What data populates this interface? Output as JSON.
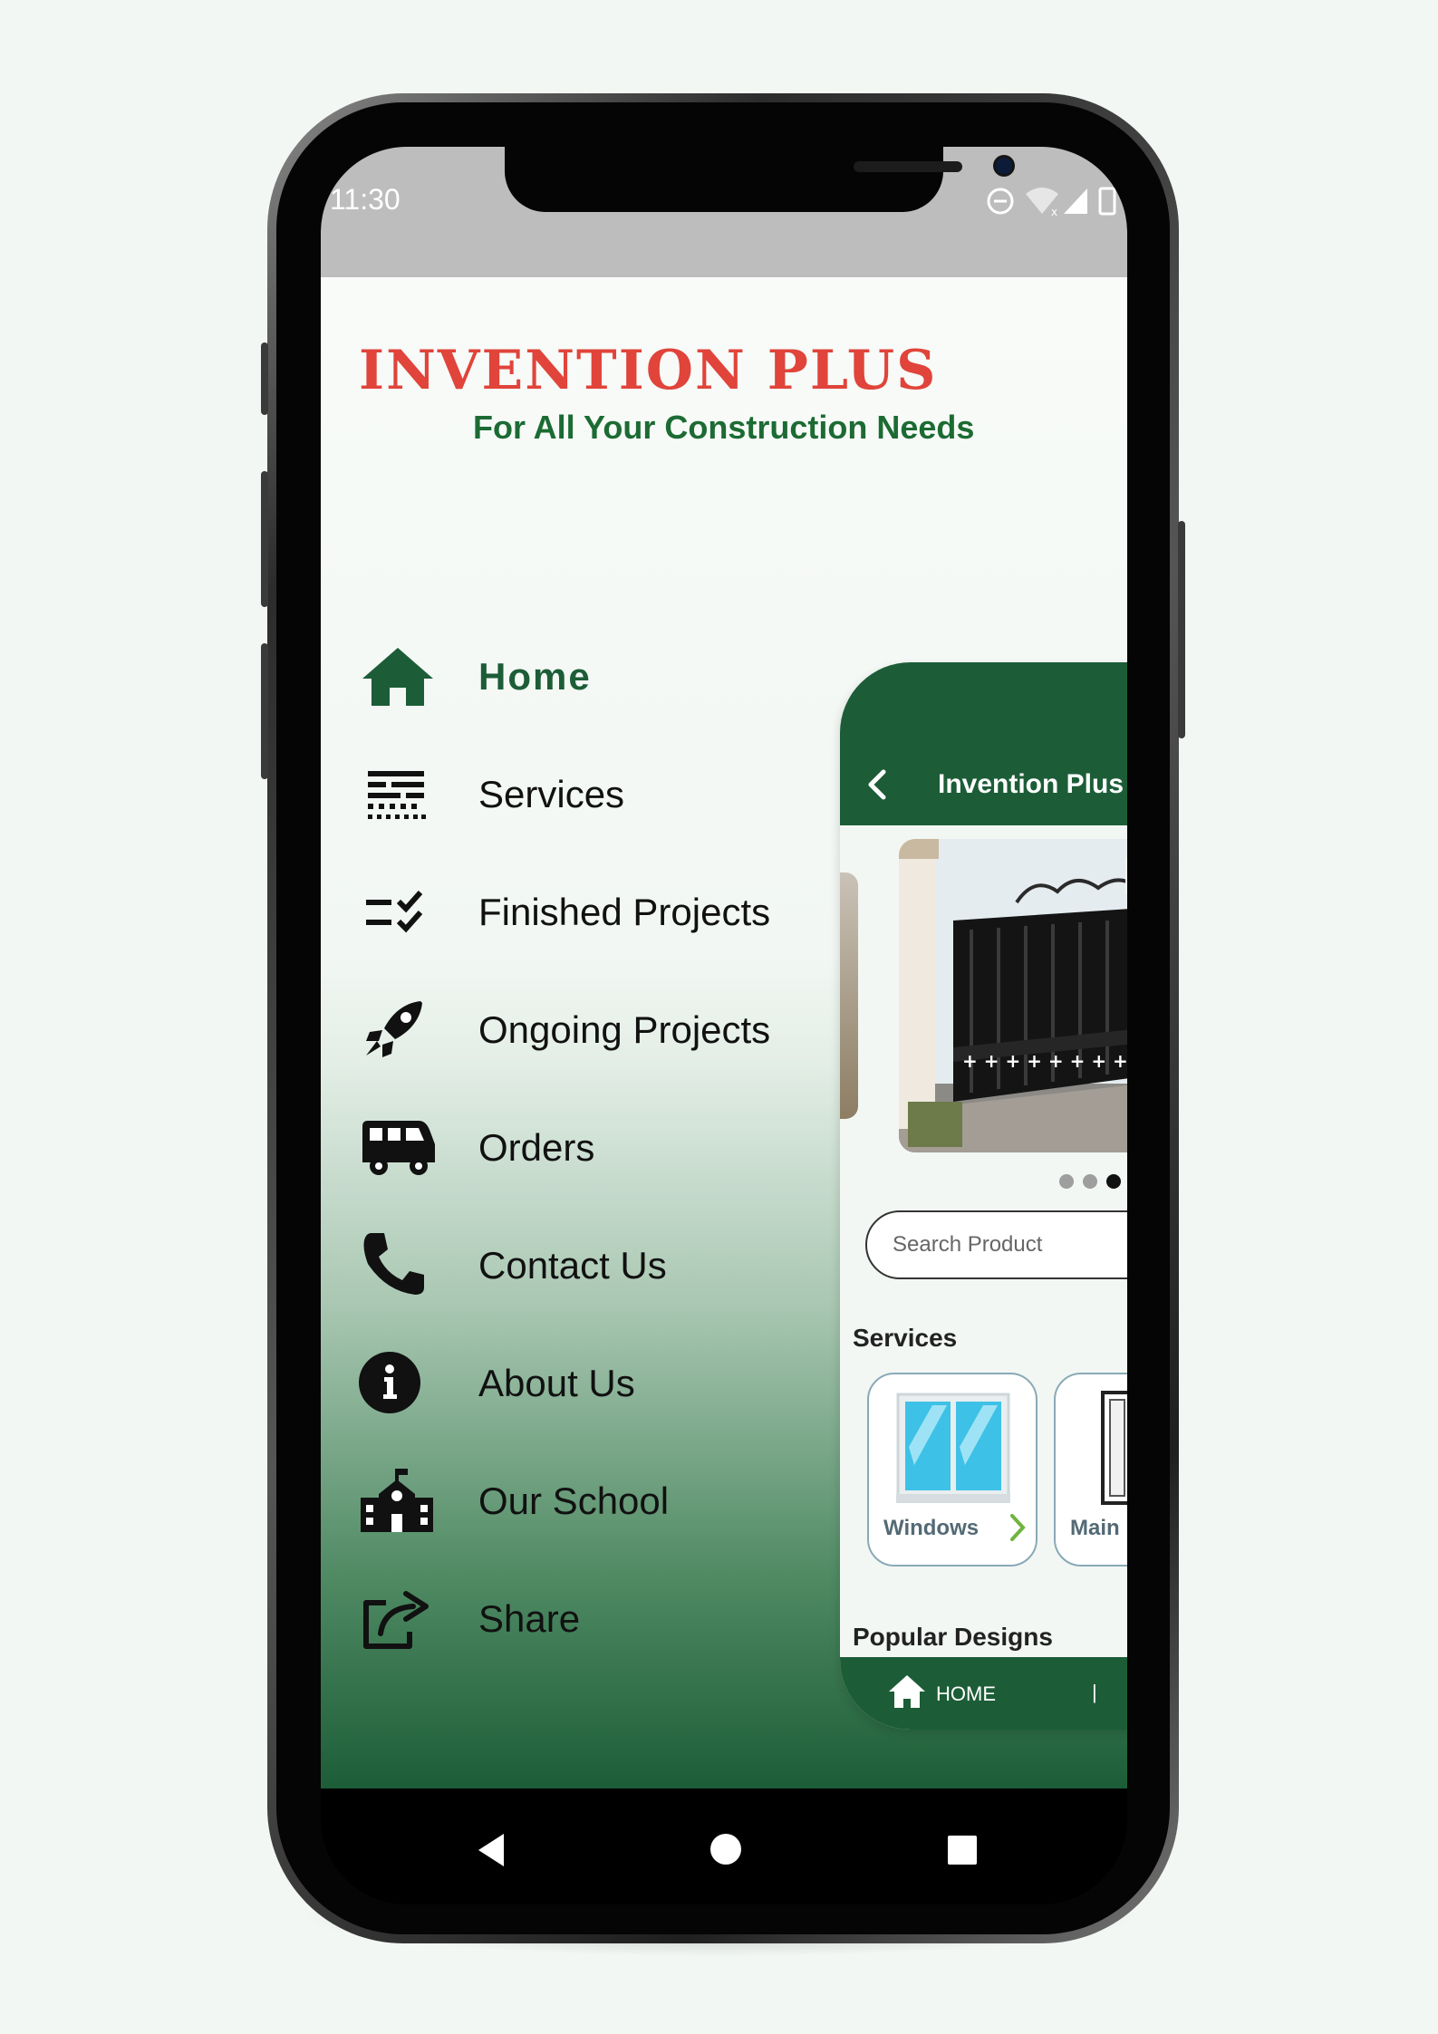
{
  "status_bar": {
    "time": "11:30"
  },
  "brand": {
    "title": "INVENTION PLUS",
    "tagline": "For All Your Construction Needs",
    "title_color": "#e0443a",
    "tagline_color": "#1c6b33",
    "accent": "#1c5d37"
  },
  "drawer": {
    "items": [
      {
        "label": "Home",
        "icon": "home-icon",
        "active": true
      },
      {
        "label": "Services",
        "icon": "services-icon",
        "active": false
      },
      {
        "label": "Finished Projects",
        "icon": "checklist-icon",
        "active": false
      },
      {
        "label": "Ongoing Projects",
        "icon": "rocket-icon",
        "active": false
      },
      {
        "label": "Orders",
        "icon": "van-icon",
        "active": false
      },
      {
        "label": "Contact Us",
        "icon": "phone-icon",
        "active": false
      },
      {
        "label": "About Us",
        "icon": "info-icon",
        "active": false
      },
      {
        "label": "Our School",
        "icon": "school-icon",
        "active": false
      },
      {
        "label": "Share",
        "icon": "share-icon",
        "active": false
      }
    ]
  },
  "preview": {
    "header_title": "Invention Plus C",
    "carousel": {
      "dot_count": 3,
      "active_dot": 3
    },
    "search_placeholder": "Search Product",
    "services_heading": "Services",
    "service_cards": [
      {
        "label": "Windows",
        "icon": "window-icon"
      },
      {
        "label": "Main D",
        "icon": "door-icon"
      }
    ],
    "popular_heading": "Popular Designs",
    "bottom_nav": {
      "label": "HOME",
      "separator": "|"
    }
  },
  "system_nav": {
    "buttons": [
      "back",
      "home",
      "recents"
    ]
  }
}
